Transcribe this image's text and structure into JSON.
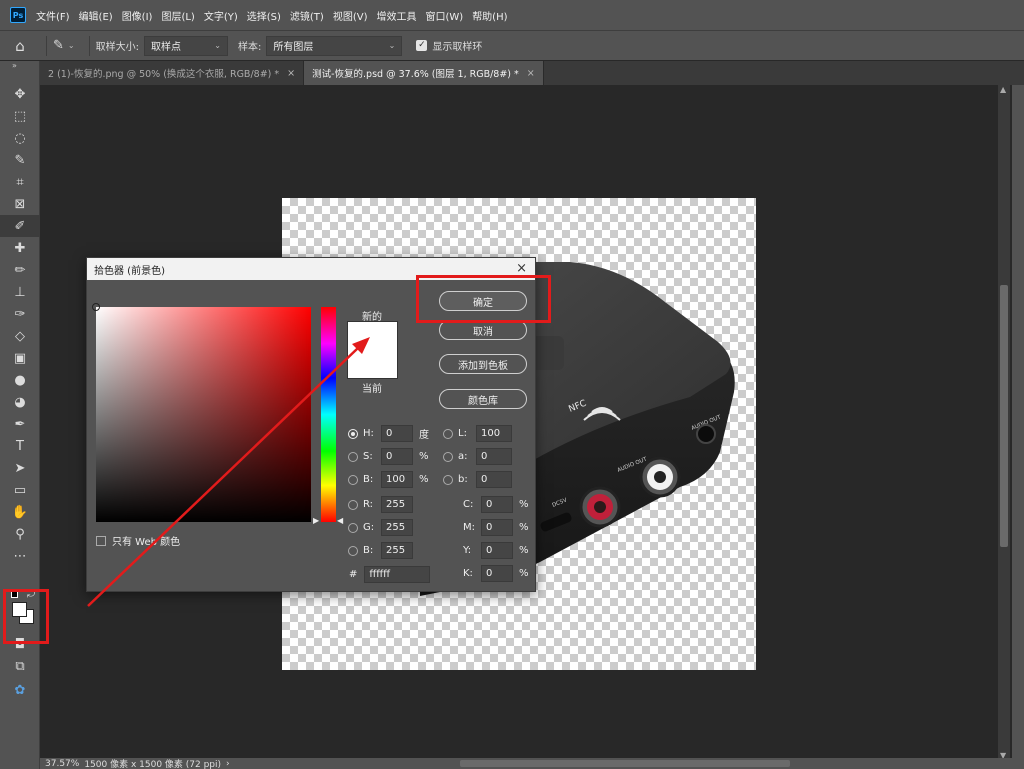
{
  "menubar": {
    "logo": "Ps",
    "items": [
      "文件(F)",
      "编辑(E)",
      "图像(I)",
      "图层(L)",
      "文字(Y)",
      "选择(S)",
      "滤镜(T)",
      "视图(V)",
      "增效工具",
      "窗口(W)",
      "帮助(H)"
    ]
  },
  "options": {
    "sample_size_label": "取样大小:",
    "sample_size_value": "取样点",
    "sample_label": "样本:",
    "sample_value": "所有图层",
    "show_ring_label": "显示取样环"
  },
  "tabs": [
    {
      "label": "2 (1)-恢复的.png @ 50% (换成这个衣服, RGB/8#) *",
      "close": "×"
    },
    {
      "label": "测试-恢复的.psd @ 37.6% (图层 1, RGB/8#) *",
      "close": "×"
    }
  ],
  "status": {
    "zoom": "37.57%",
    "doc_size": "1500 像素 x 1500 像素 (72 ppi)",
    "arrow": "›"
  },
  "device_labels": {
    "nfc": "NFC",
    "audio_out_1": "AUDIO OUT",
    "audio_out_2": "AUDIO OUT",
    "dc": "DC5V"
  },
  "dialog": {
    "title": "拾色器 (前景色)",
    "close": "×",
    "ok": "确定",
    "cancel": "取消",
    "add_swatch": "添加到色板",
    "color_libraries": "颜色库",
    "new_label": "新的",
    "current_label": "当前",
    "web_only": "只有 Web 颜色",
    "new_color": "#ffffff",
    "current_color": "#ffffff",
    "hsb": {
      "h": {
        "label": "H:",
        "value": "0",
        "unit": "度"
      },
      "s": {
        "label": "S:",
        "value": "0",
        "unit": "%"
      },
      "b": {
        "label": "B:",
        "value": "100",
        "unit": "%"
      }
    },
    "rgb": {
      "r": {
        "label": "R:",
        "value": "255"
      },
      "g": {
        "label": "G:",
        "value": "255"
      },
      "b": {
        "label": "B:",
        "value": "255"
      }
    },
    "lab": {
      "l": {
        "label": "L:",
        "value": "100"
      },
      "a": {
        "label": "a:",
        "value": "0"
      },
      "b": {
        "label": "b:",
        "value": "0"
      }
    },
    "cmyk": {
      "c": {
        "label": "C:",
        "value": "0",
        "unit": "%"
      },
      "m": {
        "label": "M:",
        "value": "0",
        "unit": "%"
      },
      "y": {
        "label": "Y:",
        "value": "0",
        "unit": "%"
      },
      "k": {
        "label": "K:",
        "value": "0",
        "unit": "%"
      }
    },
    "hex": {
      "label": "#",
      "value": "ffffff"
    }
  },
  "colors": {
    "annotation_red": "#e21b1b",
    "foreground": "#ffffff",
    "background": "#ffffff"
  },
  "icons": {
    "tools": [
      "move-icon",
      "marquee-icon",
      "lasso-icon",
      "quick-select-icon",
      "crop-icon",
      "frame-icon",
      "eyedropper-icon",
      "healing-brush-icon",
      "brush-icon",
      "stamp-icon",
      "history-brush-icon",
      "eraser-icon",
      "gradient-icon",
      "blur-icon",
      "dodge-icon",
      "pen-icon",
      "text-icon",
      "path-select-icon",
      "rectangle-icon",
      "hand-icon",
      "zoom-icon",
      "more-icon"
    ]
  }
}
